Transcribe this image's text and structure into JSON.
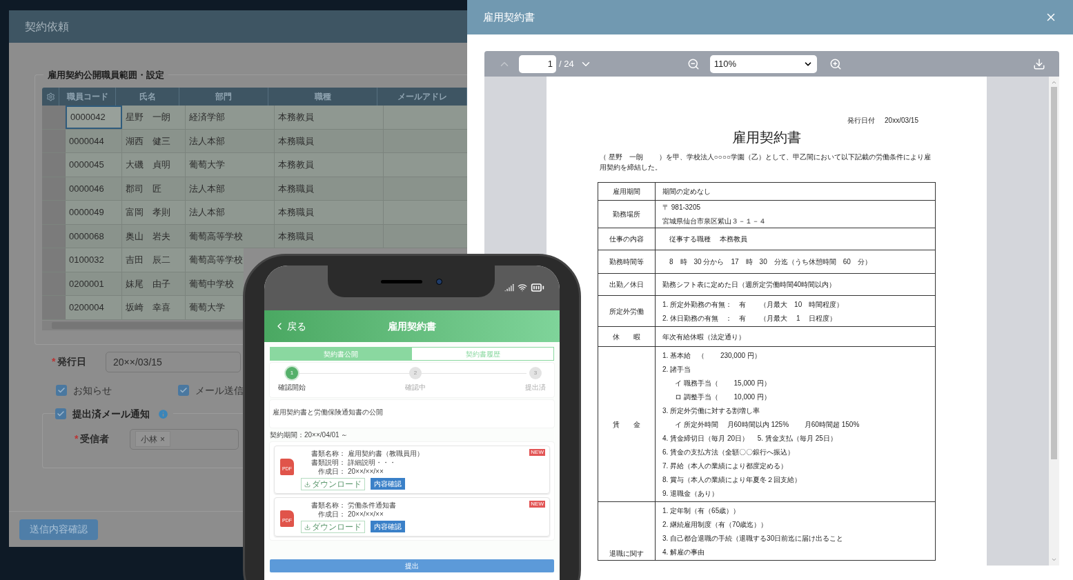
{
  "dialog": {
    "title": "契約依頼",
    "section_title": "雇用契約公開職員範囲・設定",
    "table": {
      "columns": [
        "職員コード",
        "氏名",
        "部門",
        "職種",
        "メールアドレ"
      ],
      "rows": [
        {
          "code": "0000042",
          "name": "星野　一朗",
          "department": "経済学部",
          "job_type": "本務教員",
          "selected": true
        },
        {
          "code": "0000044",
          "name": "湖西　健三",
          "department": "法人本部",
          "job_type": "本務職員",
          "selected": false
        },
        {
          "code": "0000045",
          "name": "大磯　貞明",
          "department": "葡萄大学",
          "job_type": "本務教員",
          "selected": false
        },
        {
          "code": "0000046",
          "name": "郡司　匠",
          "department": "法人本部",
          "job_type": "本務職員",
          "selected": false
        },
        {
          "code": "0000049",
          "name": "富岡　孝則",
          "department": "法人本部",
          "job_type": "本務職員",
          "selected": false
        },
        {
          "code": "0000068",
          "name": "奥山　岩夫",
          "department": "葡萄高等学校",
          "job_type": "本務職員",
          "selected": false
        },
        {
          "code": "0100032",
          "name": "吉田　辰二",
          "department": "葡萄高等学校",
          "selected": false
        },
        {
          "code": "0200001",
          "name": "妹尾　由子",
          "department": "葡萄中学校",
          "selected": false
        },
        {
          "code": "0200004",
          "name": "坂崎　幸喜",
          "department": "葡萄大学",
          "selected": false
        }
      ]
    },
    "issue_date": {
      "label": "発行日",
      "required_mark": "*",
      "value": "20××/03/15"
    },
    "options": [
      {
        "label": "お知らせ",
        "checked": true
      },
      {
        "label": "メール送信",
        "checked": true
      }
    ],
    "mail_notice": {
      "label": "提出済メール通知",
      "checked": true,
      "recipient": {
        "label": "受信者",
        "required_mark": "*",
        "tags": [
          {
            "name": "小林",
            "remove": "×"
          }
        ]
      }
    },
    "confirm_button": "送信内容確認"
  },
  "viewer": {
    "title": "雇用契約書",
    "toolbar": {
      "page": "1",
      "total": "/ 24",
      "zoom": "110%"
    },
    "document": {
      "issue_date_label": "発行日付",
      "issue_date": "20xx/03/15",
      "title": "雇用契約書",
      "intro": "（ 星野　一朗　　 ）を甲、学校法人○○○○学園（乙）として、甲乙間において以下記載の労働条件により雇用契約を締結した。",
      "rows": [
        {
          "label": "雇用期間",
          "lines": [
            {
              "text": "期間の定めなし"
            }
          ]
        },
        {
          "label": "勤務場所",
          "lines": [
            {
              "text": "〒 981-3205"
            },
            {
              "text": "宮城県仙台市泉区紫山３－１－４"
            }
          ]
        },
        {
          "label": "仕事の内容",
          "lines": [
            {
              "text": "　従事する職種　 本務教員"
            }
          ]
        },
        {
          "label": "勤務時間等",
          "lines": [
            {
              "text": "　8　時　30 分から　17　時　30　分迄（うち休憩時間　60　分）"
            }
          ]
        },
        {
          "label": "出勤／休日",
          "lines": [
            {
              "text": "勤務シフト表に定めた日（週所定労働時間40時間以内）"
            }
          ]
        },
        {
          "label": "所定外労働",
          "lines": [
            {
              "text": "1. 所定外勤務の有無：　有　　（月最大　10　時間程度）"
            },
            {
              "text": "2. 休日勤務の有無　：　有　　（月最大　 1　 日程度）"
            }
          ]
        },
        {
          "label": "休　　暇",
          "lines": [
            {
              "text": "年次有給休暇（法定通り）"
            }
          ]
        },
        {
          "label": "賃　　金",
          "lines": [
            {
              "text": "1. 基本給　（　　 230,000 円）"
            },
            {
              "text": "2. 諸手当",
              "children": [
                {
                  "text": "イ 職務手当（　　 15,000 円）"
                },
                {
                  "text": "ロ 調整手当（　　 10,000 円）"
                }
              ]
            },
            {
              "text": "3. 所定外労働に対する割増し率",
              "children": [
                {
                  "text": "イ 所定外時間　 月60時間以内 125%　　 月60時間超 150%"
                }
              ]
            },
            {
              "text": "4. 賃金締切日（毎月 20日）　 5. 賃金支払（毎月 25日）"
            },
            {
              "text": "6. 賃金の支払方法（全額〇〇銀行へ振込）"
            },
            {
              "text": "7. 昇給（本人の業績により都度定める）"
            },
            {
              "text": "8. 賞与（本人の業績により年夏冬２回支給）"
            },
            {
              "text": "9. 退職金（あり）"
            }
          ]
        },
        {
          "label": "退職に関す",
          "lines": [
            {
              "text": "1. 定年制（有（65歳））"
            },
            {
              "text": "2. 継続雇用制度（有（70歳迄））"
            },
            {
              "text": "3. 自己都合退職の手続（退職する30日前迄に届け出ること"
            },
            {
              "text": "4. 解雇の事由"
            }
          ]
        }
      ]
    }
  },
  "phone": {
    "back": "戻る",
    "title": "雇用契約書",
    "tabs": [
      {
        "label": "契約書公開",
        "selected": true
      },
      {
        "label": "契約書履歴",
        "selected": false
      }
    ],
    "steps": [
      {
        "number": "1",
        "label": "確認開始",
        "selected": true
      },
      {
        "number": "2",
        "label": "確認中",
        "selected": false
      },
      {
        "number": "3",
        "label": "提出済",
        "selected": false
      }
    ],
    "notice": "雇用契約書と労働保険通知書の公開",
    "period": "契約期間：20××/04/01 ～",
    "documents": [
      {
        "file_type": "PDF",
        "badge": "NEW",
        "fields": [
          {
            "label": "書類名称：",
            "value": "雇用契約書（教職員用）"
          },
          {
            "label": "書類説明：",
            "value": "詳細説明・・・"
          },
          {
            "label": "作成日：",
            "value": "20××/××/××"
          }
        ],
        "download": {
          "label": "ダウンロード",
          "disabled": true
        },
        "view": "内容確認"
      },
      {
        "file_type": "PDF",
        "badge": "NEW",
        "fields": [
          {
            "label": "書類名称：",
            "value": "労働条件通知書"
          },
          {
            "label": "作成日：",
            "value": "20××/××/××"
          }
        ],
        "download": {
          "label": "ダウンロード",
          "disabled": true
        },
        "view": "内容確認"
      }
    ],
    "submit": "提出"
  }
}
